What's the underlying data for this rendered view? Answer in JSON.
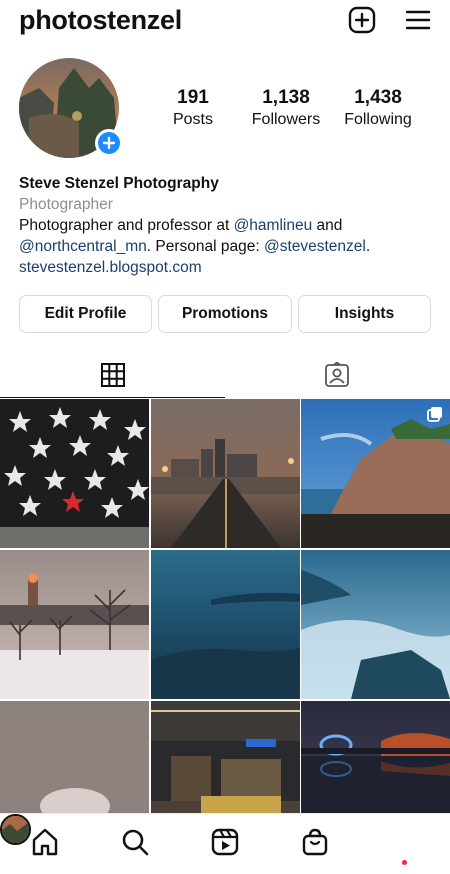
{
  "header": {
    "username": "photostenzel",
    "new_post_icon": "plus-square-icon",
    "menu_icon": "hamburger-menu-icon"
  },
  "profile": {
    "stats": [
      {
        "value": "191",
        "label": "Posts"
      },
      {
        "value": "1,138",
        "label": "Followers"
      },
      {
        "value": "1,438",
        "label": "Following"
      }
    ]
  },
  "bio": {
    "name": "Steve Stenzel Photography",
    "category": "Photographer",
    "line1_text": "Photographer and professor at ",
    "line1_mention": "@hamlineu",
    "line1_end": " and",
    "line2_mention": "@northcentral_mn",
    "line2_text": ". Personal page: ",
    "line2_mention2": "@stevestenzel",
    "line2_end": ".",
    "website": "stevestenzel.blogspot.com"
  },
  "actions": {
    "edit_profile": "Edit Profile",
    "promotions": "Promotions",
    "insights": "Insights"
  },
  "tabs": [
    "grid-icon",
    "tagged-icon"
  ],
  "grid": {
    "posts": [
      "stars-wall",
      "night-bridge-road",
      "rocky-lake-shore",
      "snowy-park-night",
      "blue-lake-long-exposure",
      "misty-rocks-waves",
      "foggy-night-tree",
      "street-construction-night",
      "lit-bridge-river"
    ]
  },
  "nav": [
    "home-icon",
    "search-icon",
    "reels-icon",
    "shop-icon",
    "profile-avatar"
  ],
  "colors": {
    "accent_blue": "#1a8cff",
    "link_blue": "#1c3f6e",
    "notification_red": "#ff1f3d",
    "muted_text": "#8e8e8e"
  }
}
